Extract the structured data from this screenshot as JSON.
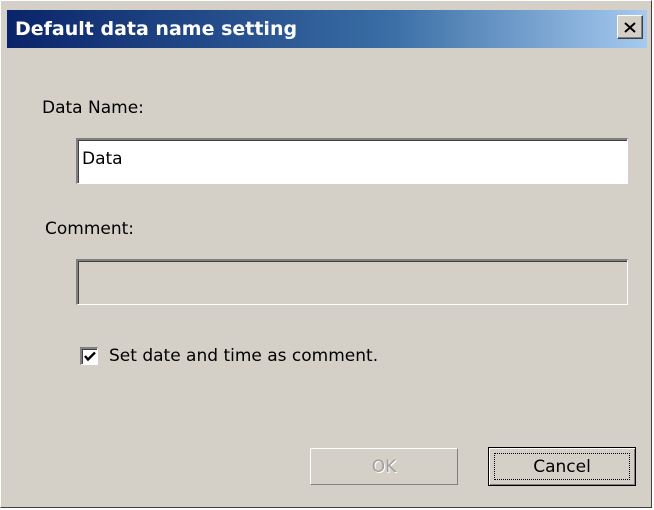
{
  "window": {
    "title": "Default data name setting",
    "close_icon": "close-x-icon"
  },
  "form": {
    "data_name_label": "Data Name:",
    "data_name_value": "Data",
    "comment_label": "Comment:",
    "comment_value": "",
    "comment_enabled": false,
    "set_datetime_label": "Set date and time as comment.",
    "set_datetime_checked": true
  },
  "buttons": {
    "ok_label": "OK",
    "ok_enabled": false,
    "cancel_label": "Cancel"
  }
}
